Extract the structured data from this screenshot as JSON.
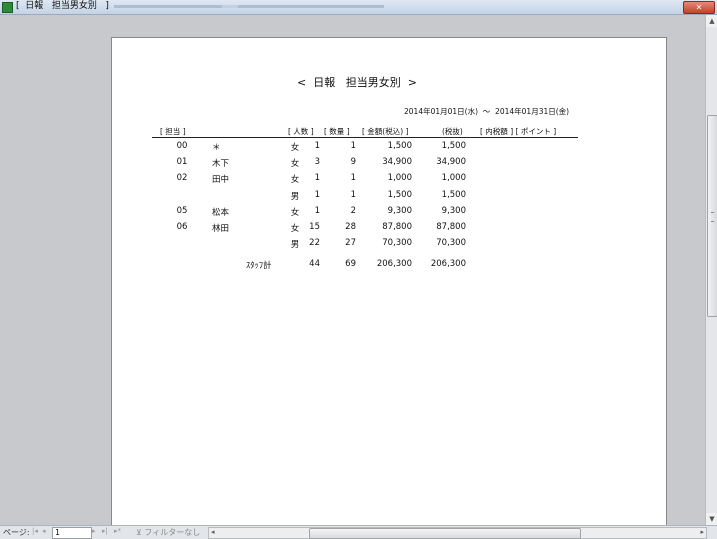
{
  "window": {
    "title": "[  日報   担当男女別   ]"
  },
  "report": {
    "title": "<  日報   担当男女別  >",
    "date_range": "2014年01月01日(水)  ～  2014年01月31日(金)",
    "headers": {
      "staff": "[ 担当 ]",
      "count": "[ 人数 ]",
      "qty": "[ 数量 ]",
      "amount_incl": "[ 金額(税込) ]",
      "amount_excl": "(税抜)",
      "tax_points": "[ 内税額 ] [ ポイント ]"
    },
    "rows": [
      {
        "code": "00",
        "name": "＊",
        "gender": "女",
        "count": "1",
        "qty": "1",
        "incl": "1,500",
        "excl": "1,500"
      },
      {
        "code": "01",
        "name": "木下",
        "gender": "女",
        "count": "3",
        "qty": "9",
        "incl": "34,900",
        "excl": "34,900"
      },
      {
        "code": "02",
        "name": "田中",
        "gender": "女",
        "count": "1",
        "qty": "1",
        "incl": "1,000",
        "excl": "1,000"
      },
      {
        "code": "",
        "name": "",
        "gender": "男",
        "count": "1",
        "qty": "1",
        "incl": "1,500",
        "excl": "1,500"
      },
      {
        "code": "05",
        "name": "松本",
        "gender": "女",
        "count": "1",
        "qty": "2",
        "incl": "9,300",
        "excl": "9,300"
      },
      {
        "code": "06",
        "name": "林田",
        "gender": "女",
        "count": "15",
        "qty": "28",
        "incl": "87,800",
        "excl": "87,800"
      },
      {
        "code": "",
        "name": "",
        "gender": "男",
        "count": "22",
        "qty": "27",
        "incl": "70,300",
        "excl": "70,300"
      }
    ],
    "total": {
      "label": "ｽﾀｯﾌ計",
      "count": "44",
      "qty": "69",
      "incl": "206,300",
      "excl": "206,300"
    }
  },
  "navbar": {
    "page_label": "ページ:",
    "page_value": "1",
    "filter_label": "フィルターなし"
  }
}
